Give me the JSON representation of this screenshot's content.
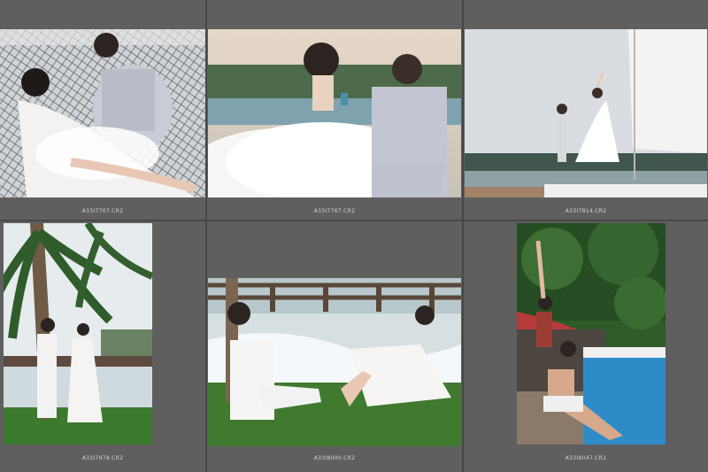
{
  "filmstrip": {
    "items": [
      {
        "filename": "A33I7707.CR2",
        "thumbnail_icon": "photo-couple-net-icon"
      },
      {
        "filename": "A33I7767.CR2",
        "thumbnail_icon": "photo-couple-dress-icon"
      },
      {
        "filename": "A33I7814.CR2",
        "thumbnail_icon": "photo-couple-yacht-icon"
      },
      {
        "filename": "A33I7978.CR2",
        "thumbnail_icon": "photo-couple-palm-icon"
      },
      {
        "filename": "A33I8000.CR2",
        "thumbnail_icon": "photo-couple-lawn-icon"
      },
      {
        "filename": "A33I8047.CR2",
        "thumbnail_icon": "photo-couple-pool-icon"
      }
    ]
  },
  "colors": {
    "cell_bg": "#5f5f5f",
    "grid_bg": "#474747",
    "label_text": "#d6d6d6"
  }
}
